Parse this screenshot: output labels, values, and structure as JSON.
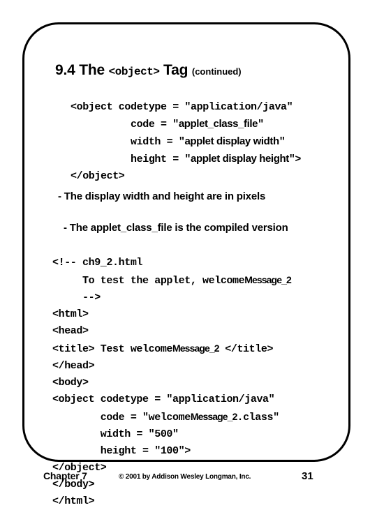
{
  "slide": {
    "title": {
      "prefix": "9.4 The ",
      "mono_tag": "<object>",
      "middle": " Tag ",
      "suffix": "(continued)"
    },
    "syntax_block": {
      "line1_pre": "<object codetype = \"application/java\"",
      "line2_pre": "          code = \"",
      "line2_value": "applet_class_file",
      "line2_post": "\"",
      "line3_pre": "          width = \"",
      "line3_value": "applet display width",
      "line3_post": "\"",
      "line4_pre": "          height = \"",
      "line4_value": "applet display height",
      "line4_post": "\">",
      "line5": "</object>"
    },
    "bullets": [
      "- The display width and height are in pixels",
      "- The applet_class_file is the compiled version"
    ],
    "example_block": {
      "line1": "<!-- ch9_2.html",
      "line2_pre": "     To test the applet, welcome",
      "line2_narrow": "Message_2",
      "line3": "     -->",
      "line4": "<html>",
      "line5": "<head>",
      "line6_pre": "<title> Test welcome",
      "line6_narrow": "Message_2",
      "line6_post": " </title>",
      "line7": "</head>",
      "line8": "<body>",
      "line9": "<object codetype = \"application/java\"",
      "line10_pre": "        code = \"welcome",
      "line10_narrow": "Message_2",
      "line10_post": ".class\"",
      "line11": "        width = \"500\"",
      "line12": "        height = \"100\">",
      "line13": "</object>",
      "line14": "</body>",
      "line15": "</html>"
    },
    "footer": {
      "chapter": "Chapter 7",
      "copyright": "© 2001 by Addison Wesley Longman, Inc.",
      "page_number": "31"
    }
  }
}
